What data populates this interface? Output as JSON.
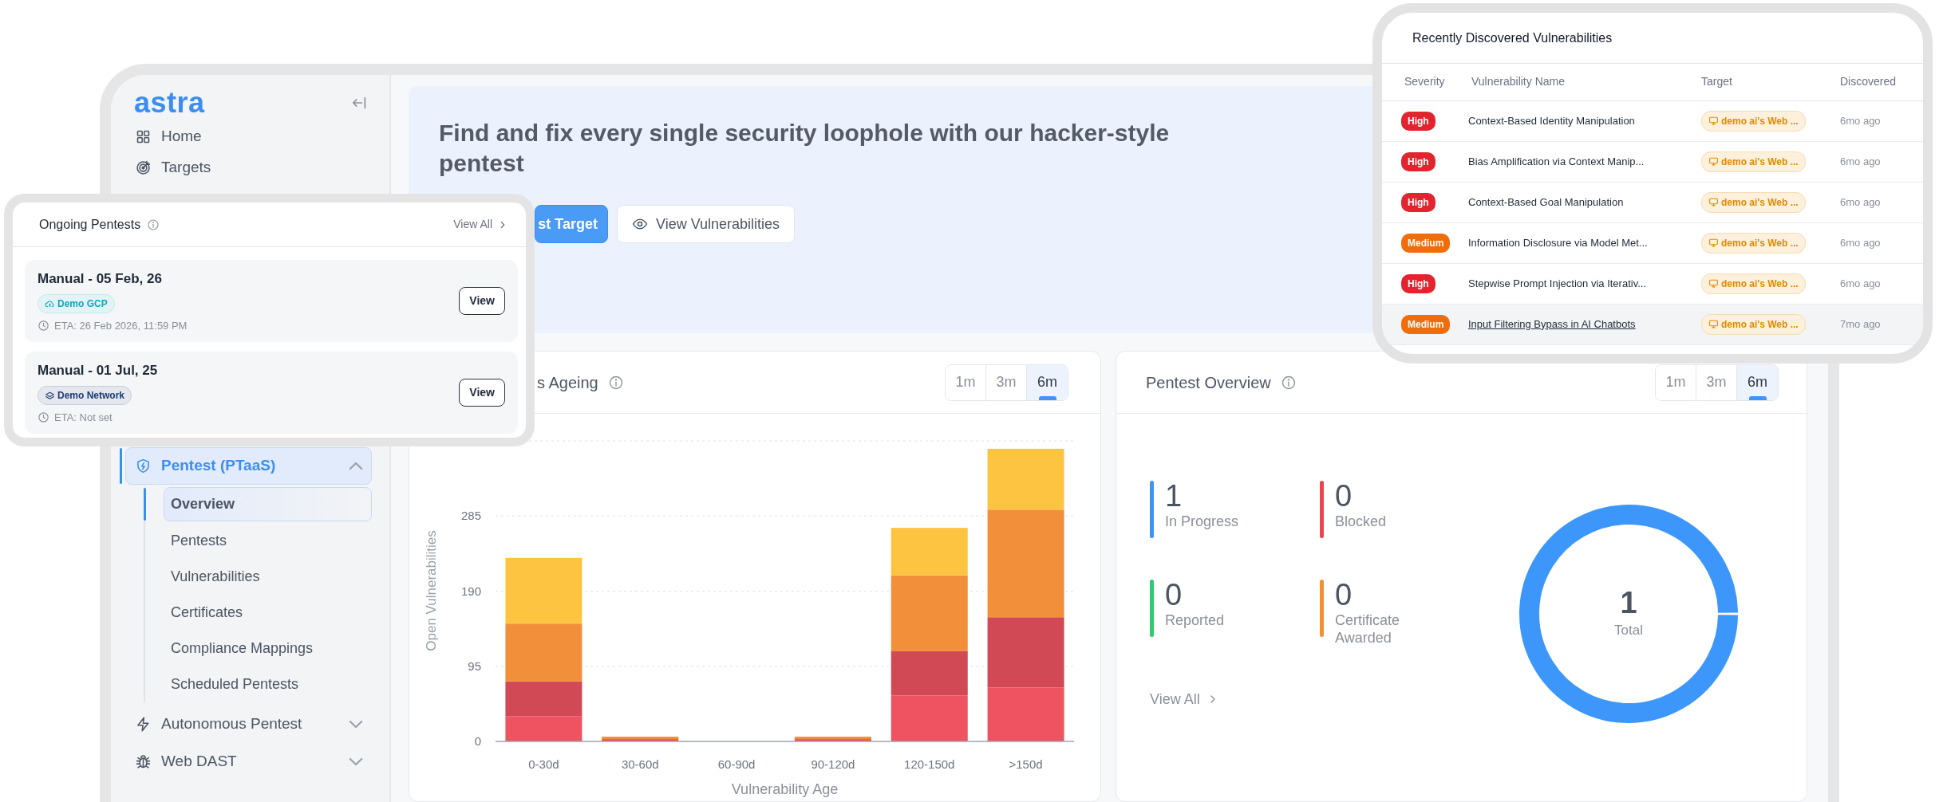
{
  "sidebar": {
    "logo": "astra",
    "items": [
      {
        "label": "Home",
        "kind": "link",
        "selected": false
      },
      {
        "label": "Targets",
        "kind": "link",
        "selected": false
      },
      {
        "label": "Pentest (PTaaS)",
        "kind": "group",
        "selected": true,
        "expanded": true,
        "children": [
          {
            "label": "Overview",
            "selected": true
          },
          {
            "label": "Pentests",
            "selected": false
          },
          {
            "label": "Vulnerabilities",
            "selected": false
          },
          {
            "label": "Certificates",
            "selected": false
          },
          {
            "label": "Compliance Mappings",
            "selected": false
          },
          {
            "label": "Scheduled Pentests",
            "selected": false
          }
        ]
      },
      {
        "label": "Autonomous Pentest",
        "kind": "group",
        "selected": false,
        "expanded": false
      },
      {
        "label": "Web DAST",
        "kind": "group",
        "selected": false,
        "expanded": false
      }
    ]
  },
  "hero": {
    "title": "Find and fix every single security loophole with our hacker-style pentest",
    "buttons": [
      {
        "label": "st Target",
        "kind": "primary"
      },
      {
        "label": "View Vulnerabilities",
        "kind": "secondary"
      }
    ]
  },
  "ageing_card": {
    "title": "s Ageing",
    "ranges": [
      {
        "label": "1m",
        "selected": false
      },
      {
        "label": "3m",
        "selected": false
      },
      {
        "label": "6m",
        "selected": true
      }
    ],
    "chart_data": {
      "type": "bar",
      "stacked": true,
      "xlabel": "Vulnerability Age",
      "ylabel": "Open Vulnerabilities",
      "categories": [
        "0-30d",
        "30-60d",
        "60-90d",
        "90-120d",
        "120-150d",
        ">150d"
      ],
      "ylim": [
        0,
        380
      ],
      "yticks": [
        0,
        95,
        190,
        285
      ],
      "grid": true,
      "series": [
        {
          "color": "#ef5362",
          "values": [
            32,
            3,
            0,
            3,
            58,
            68
          ]
        },
        {
          "color": "#d04954",
          "values": [
            44,
            0,
            0,
            0,
            56,
            89
          ]
        },
        {
          "color": "#f28f3b",
          "values": [
            73,
            3,
            0,
            3,
            96,
            136
          ]
        },
        {
          "color": "#fdc441",
          "values": [
            83,
            0,
            0,
            0,
            60,
            77
          ]
        }
      ]
    }
  },
  "overview_card": {
    "title": "Pentest Overview",
    "ranges": [
      {
        "label": "1m",
        "selected": false
      },
      {
        "label": "3m",
        "selected": false
      },
      {
        "label": "6m",
        "selected": true
      }
    ],
    "stats": [
      {
        "value": "1",
        "label": "In Progress",
        "color": "#3d95f6"
      },
      {
        "value": "0",
        "label": "Blocked",
        "color": "#e5484d"
      },
      {
        "value": "0",
        "label": "Reported",
        "color": "#2ecc71"
      },
      {
        "value": "0",
        "label": "Certificate Awarded",
        "color": "#f0913a"
      }
    ],
    "view_all": "View All",
    "donut": {
      "value": "1",
      "label": "Total"
    }
  },
  "ongoing_pentests": {
    "title": "Ongoing Pentests",
    "view_all": "View All",
    "items": [
      {
        "title": "Manual - 05 Feb, 26",
        "target": "Demo GCP",
        "kind": "cloud",
        "color": "#12a5bd",
        "eta": "ETA: 26 Feb 2026, 11:59 PM",
        "button": "View"
      },
      {
        "title": "Manual - 01 Jul, 25",
        "target": "Demo Network",
        "kind": "network",
        "color": "#1d3b70",
        "eta": "ETA: Not set",
        "button": "View"
      }
    ]
  },
  "recent_vulnerabilities": {
    "title": "Recently Discovered Vulnerabilities",
    "columns": [
      "Severity",
      "Vulnerability Name",
      "Target",
      "Discovered"
    ],
    "rows": [
      {
        "severity": "High",
        "color": "#e3242f",
        "name": "Context-Based Identity Manipulation",
        "target": "demo ai's Web ...",
        "discovered": "6mo ago",
        "selected": false
      },
      {
        "severity": "High",
        "color": "#e3242f",
        "name": "Bias Amplification via Context Manip...",
        "target": "demo ai's Web ...",
        "discovered": "6mo ago",
        "selected": false
      },
      {
        "severity": "High",
        "color": "#e3242f",
        "name": "Context-Based Goal Manipulation",
        "target": "demo ai's Web ...",
        "discovered": "6mo ago",
        "selected": false
      },
      {
        "severity": "Medium",
        "color": "#f06d0a",
        "name": "Information Disclosure via Model Met...",
        "target": "demo ai's Web ...",
        "discovered": "6mo ago",
        "selected": false
      },
      {
        "severity": "High",
        "color": "#e3242f",
        "name": "Stepwise Prompt Injection via Iterativ...",
        "target": "demo ai's Web ...",
        "discovered": "6mo ago",
        "selected": false
      },
      {
        "severity": "Medium",
        "color": "#f06d0a",
        "name": "Input Filtering Bypass in AI Chatbots",
        "target": "demo ai's Web ...",
        "discovered": "7mo ago",
        "selected": true
      }
    ]
  }
}
